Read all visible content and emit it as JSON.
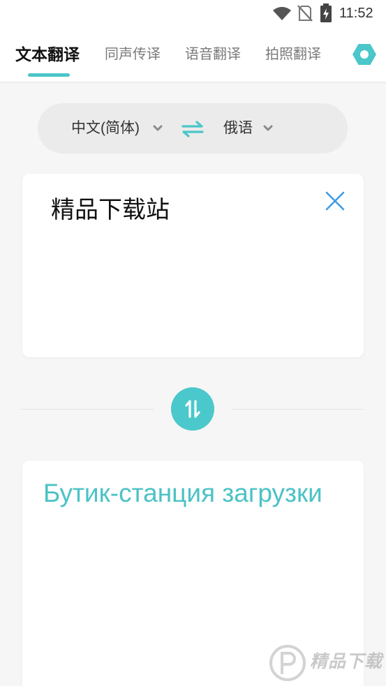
{
  "status_bar": {
    "time": "11:52",
    "icons": [
      "wifi-icon",
      "no-sim-icon",
      "battery-charging-icon"
    ]
  },
  "tabs": [
    {
      "label": "文本翻译",
      "selected": true
    },
    {
      "label": "同声传译",
      "selected": false
    },
    {
      "label": "语音翻译",
      "selected": false
    },
    {
      "label": "拍照翻译",
      "selected": false
    }
  ],
  "header": {
    "settings_icon": "hexagon-settings-icon"
  },
  "language_bar": {
    "source_language": "中文(简体)",
    "target_language": "俄语",
    "swap_icon": "swap-arrows-icon",
    "dropdown_icon": "chevron-down-icon"
  },
  "input": {
    "text": "精品下载站",
    "clear_icon": "close-icon"
  },
  "exchange_button": {
    "icon": "up-down-arrows-icon"
  },
  "output": {
    "text": "Бутик-станция загрузки"
  },
  "watermark": {
    "text": "精品下载"
  },
  "colors": {
    "accent": "#4bc6c9",
    "output_text": "#4bc2c6",
    "clear_icon": "#3d9be6",
    "primary_text": "#111111",
    "muted_text": "#7a7a7a",
    "background": "#f6f6f6",
    "language_pill": "#ebebeb",
    "card": "#ffffff"
  }
}
